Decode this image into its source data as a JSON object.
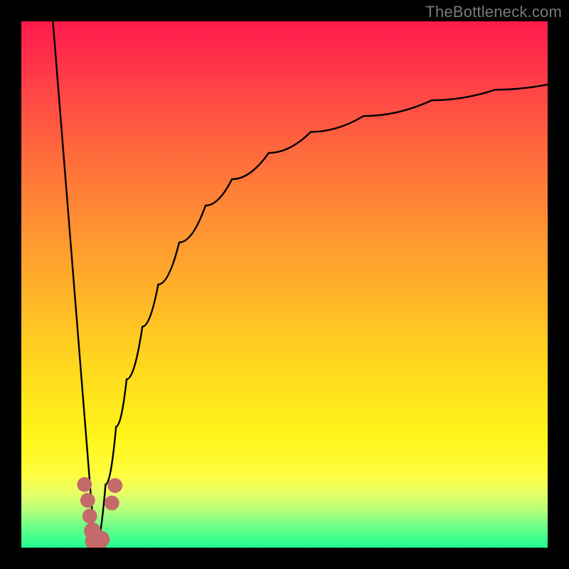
{
  "watermark": {
    "text": "TheBottleneck.com"
  },
  "colors": {
    "curve_stroke": "#000000",
    "dot_fill": "#c46a6a",
    "frame_bg": "#000000"
  },
  "chart_data": {
    "type": "line",
    "title": "",
    "xlabel": "",
    "ylabel": "",
    "xlim": [
      0,
      100
    ],
    "ylim": [
      0,
      100
    ],
    "note": "Unlabeled axes; values are approximate pixel-to-percent readings. The figure shows a V-shaped bottleneck curve: a steep linear left arm dropping to ~0 near x≈14, and a concave right arm rising asymptotically toward ~88.",
    "series": [
      {
        "name": "left_arm",
        "x": [
          6,
          8,
          10,
          12,
          14
        ],
        "values": [
          100,
          75,
          50,
          25,
          0
        ]
      },
      {
        "name": "right_arm",
        "x": [
          14,
          16,
          18,
          20,
          23,
          26,
          30,
          35,
          40,
          47,
          55,
          65,
          78,
          90,
          100
        ],
        "values": [
          0,
          12,
          23,
          32,
          42,
          50,
          58,
          65,
          70,
          75,
          79,
          82,
          85,
          87,
          88
        ]
      }
    ],
    "scatter": {
      "name": "dots",
      "note": "Soft salmon circular markers clustered near the valley floor.",
      "points": [
        {
          "x": 12.0,
          "y": 12.0,
          "r": 1.4
        },
        {
          "x": 12.6,
          "y": 9.0,
          "r": 1.4
        },
        {
          "x": 13.0,
          "y": 6.0,
          "r": 1.4
        },
        {
          "x": 13.5,
          "y": 3.2,
          "r": 1.6
        },
        {
          "x": 13.9,
          "y": 1.2,
          "r": 1.8
        },
        {
          "x": 14.4,
          "y": 0.4,
          "r": 1.8
        },
        {
          "x": 15.2,
          "y": 1.6,
          "r": 1.6
        },
        {
          "x": 17.2,
          "y": 8.5,
          "r": 1.4
        },
        {
          "x": 17.8,
          "y": 11.8,
          "r": 1.4
        }
      ]
    }
  }
}
